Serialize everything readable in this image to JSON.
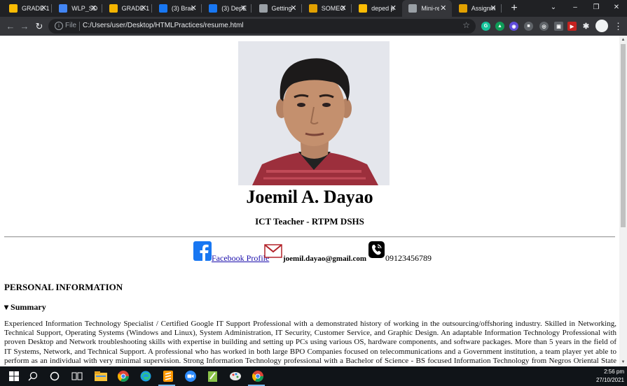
{
  "browser": {
    "tabs": [
      {
        "title": "GRADE 1",
        "icon": "google-drive-icon",
        "color": "#fbbc04"
      },
      {
        "title": "WLP_SD",
        "icon": "google-docs-icon",
        "color": "#4285f4"
      },
      {
        "title": "GRADE 1",
        "icon": "google-slides-icon",
        "color": "#f4b400"
      },
      {
        "title": "(3) Brac",
        "icon": "facebook-icon",
        "color": "#1877f2"
      },
      {
        "title": "(3) DepE",
        "icon": "facebook-icon",
        "color": "#1877f2"
      },
      {
        "title": "Getting",
        "icon": "code-icon",
        "color": "#9aa0a6"
      },
      {
        "title": "SOMEO",
        "icon": "grammarly-icon",
        "color": "#e2a100"
      },
      {
        "title": "deped p",
        "icon": "google-drive-icon",
        "color": "#fbbc04"
      },
      {
        "title": "Mini-res",
        "icon": "globe-icon",
        "color": "#9aa0a6"
      },
      {
        "title": "Assignm",
        "icon": "assignment-icon",
        "color": "#e2a100"
      }
    ],
    "active_tab": 8,
    "address": {
      "scheme_label": "File",
      "url": "C:/Users/user/Desktop/HTMLPractices/resume.html"
    }
  },
  "resume": {
    "name": "Joemil A. Dayao",
    "role": "ICT Teacher - RTPM DSHS",
    "contact": {
      "facebook_label": "Facebook Profile",
      "email": "joemil.dayao@gmail.com",
      "phone": "09123456789"
    },
    "section_heading": "PERSONAL INFORMATION",
    "summary_label": "▾ Summary",
    "summary_text": "Experienced Information Technology Specialist / Certified Google IT Support Professional with a demonstrated history of working in the outsourcing/offshoring industry. Skilled in Networking, Technical Support, Operating Systems (Windows and Linux), System Administration, IT Security, Customer Service, and Graphic Design. An adaptable Information Technology Professional with proven Desktop and Network troubleshooting skills with expertise in building and setting up PCs using various OS, hardware components, and software packages. More than 5 years in the field of IT Systems, Network, and Technical Support. A professional who has worked in both large BPO Companies focused on telecommunications and a Government institution, a team player yet able to perform as an individual with very minimal supervision. Strong Information Technology professional with a Bachelor of Science - BS focused Information Technology from Negros Oriental State University."
  },
  "taskbar": {
    "time": "2:56 pm",
    "date": "27/10/2021"
  }
}
